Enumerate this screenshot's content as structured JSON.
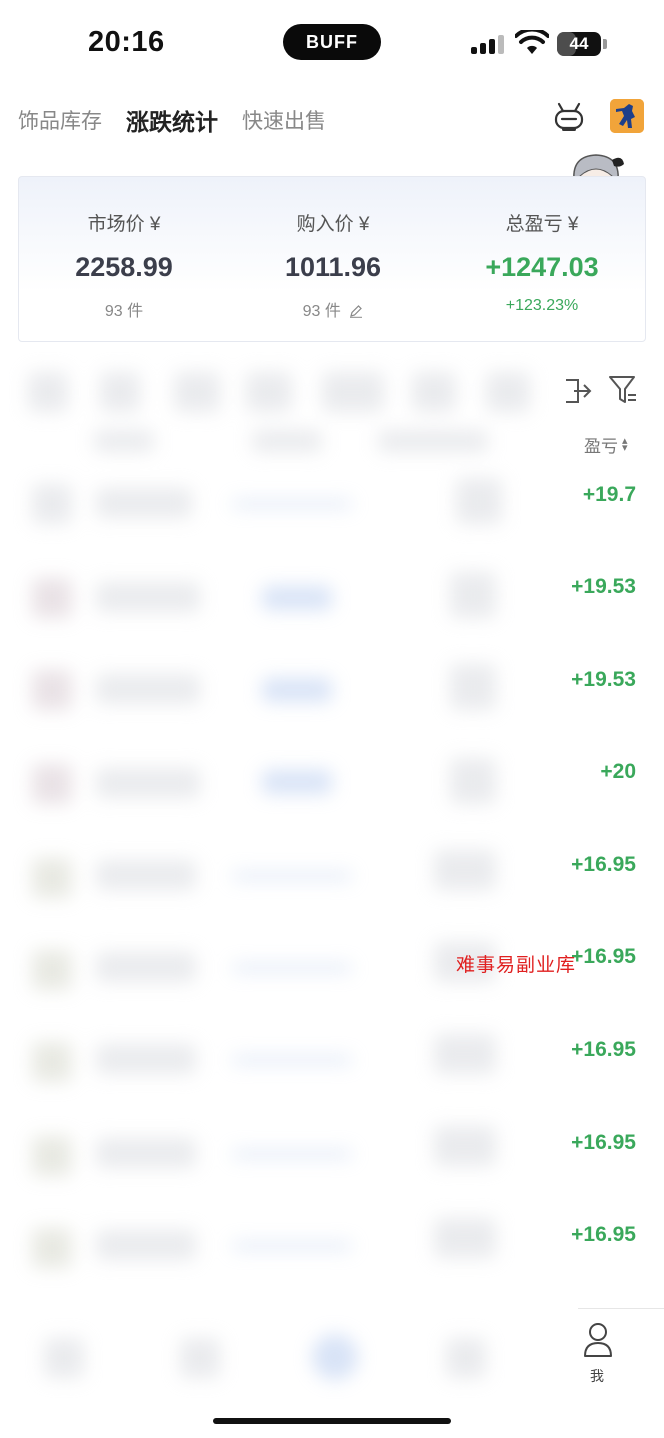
{
  "status_bar": {
    "time": "20:16",
    "island_label": "BUFF",
    "battery": "44"
  },
  "tabs": [
    {
      "label": "饰品库存",
      "active": false
    },
    {
      "label": "涨跌统计",
      "active": true
    },
    {
      "label": "快速出售",
      "active": false
    }
  ],
  "summary": {
    "market": {
      "label": "市场价 ¥",
      "value": "2258.99",
      "sub": "93 件"
    },
    "buy": {
      "label": "购入价 ¥",
      "value": "1011.96",
      "sub": "93 件"
    },
    "profit": {
      "label": "总盈亏 ¥",
      "value": "+1247.03",
      "sub": "+123.23%"
    }
  },
  "list": {
    "sort_label": "盈亏",
    "profits": [
      "+19.7",
      "+19.53",
      "+19.53",
      "+20",
      "+16.95",
      "+16.95",
      "+16.95",
      "+16.95",
      "+16.95"
    ]
  },
  "watermark": "难事易副业库",
  "bottom_nav": {
    "me_label": "我"
  },
  "colors": {
    "positive": "#3aa85b",
    "accent": "#f1a43a"
  }
}
